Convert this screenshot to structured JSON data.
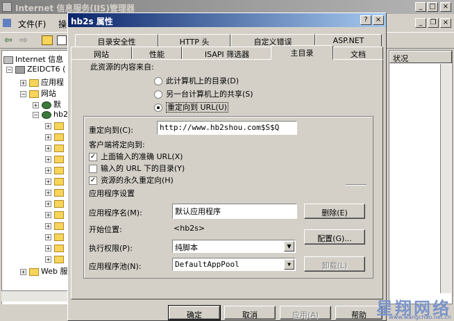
{
  "main_window": {
    "title": "Internet 信息服务(IIS)管理器",
    "menu": [
      "文件(F)",
      "操"
    ],
    "right_header": "状况",
    "tree": [
      {
        "label": "Internet 信息",
        "level": 0
      },
      {
        "label": "ZEIDCT6 (",
        "level": 1
      },
      {
        "label": "应用程",
        "level": 2
      },
      {
        "label": "网站",
        "level": 2
      },
      {
        "label": "默",
        "level": 3
      },
      {
        "label": "hb2",
        "level": 3
      },
      {
        "label": "Web 服",
        "level": 2
      }
    ]
  },
  "dialog": {
    "title": "hb2s 属性",
    "help_btn": "?",
    "close_btn": "×",
    "tabs_row1": [
      "目录安全性",
      "HTTP 头",
      "自定义错误",
      "ASP.NET"
    ],
    "tabs_row2": [
      "网站",
      "性能",
      "ISAPI 筛选器",
      "主目录",
      "文档"
    ],
    "active_tab": "主目录",
    "content_source_label": "此资源的内容来自:",
    "radios": [
      {
        "label": "此计算机上的目录(D)",
        "checked": false
      },
      {
        "label": "另一台计算机上的共享(S)",
        "checked": false
      },
      {
        "label": "重定向到 URL(U)",
        "checked": true
      }
    ],
    "redirect_label": "重定向到(C):",
    "redirect_value": "http://www.hb2shou.com$S$Q",
    "client_redirect_label": "客户端将定向到:",
    "checks": [
      {
        "label": "上面输入的准确 URL(X)",
        "checked": true
      },
      {
        "label": "输入的 URL 下的目录(Y)",
        "checked": false
      },
      {
        "label": "资源的永久重定向(H)",
        "checked": true
      }
    ],
    "app_settings_label": "应用程序设置",
    "app_name_label": "应用程序名(M):",
    "app_name_value": "默认应用程序",
    "remove_btn": "删除(E)",
    "start_pos_label": "开始位置:",
    "start_pos_value": "<hb2s>",
    "config_btn": "配置(G)...",
    "exec_perm_label": "执行权限(P):",
    "exec_perm_value": "纯脚本",
    "app_pool_label": "应用程序池(N):",
    "app_pool_value": "DefaultAppPool",
    "unload_btn": "卸载(L)",
    "ok_btn": "确定",
    "cancel_btn": "取消",
    "apply_btn": "应用(A)",
    "help_btn2": "帮助"
  },
  "watermark": {
    "text": "星翔网络",
    "url": "www.wangchao.net.cn"
  },
  "colors": {
    "dialog_title": "#0a246a",
    "face": "#d4d0c8",
    "inactive_title": "#808080"
  }
}
